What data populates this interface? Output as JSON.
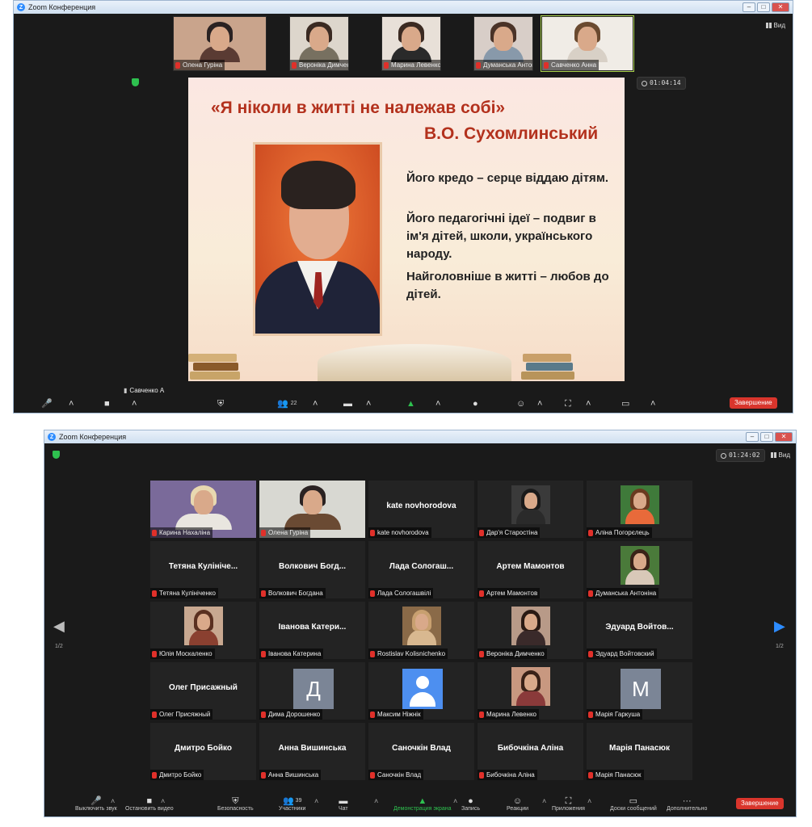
{
  "top": {
    "window_title": "Zoom Конференция",
    "thumbnails": [
      {
        "name": "Олена Гуріна",
        "bg": "#c9a48c",
        "hair": "#2a2222",
        "body": "#5a3b33"
      },
      {
        "name": "Вероніка Димченко",
        "bg": "#ddd6cc",
        "hair": "#3a2a22",
        "body": "#777060"
      },
      {
        "name": "Марина Левенко",
        "bg": "#e8e0d8",
        "hair": "#3b2a22",
        "body": "#2a2a2a"
      },
      {
        "name": "Думанська Антоніна",
        "bg": "#d8cec8",
        "hair": "#4a3328",
        "body": "#8899aa"
      },
      {
        "name": "Савченко Анна",
        "bg": "#f0ece6",
        "hair": "#6a4a30",
        "body": "#d8d0c6"
      }
    ],
    "view_label": "Вид",
    "timer": "01:04:14",
    "slide": {
      "quote": "«Я ніколи в житті не належав собі»",
      "author": "В.О. Сухомлинський",
      "lines": [
        "Його кредо – серце віддаю дітям.",
        "Його педагогічні ідеї – подвиг в ім'я дітей, школи, українського народу.",
        "Найголовніше в житті – любов до дітей."
      ]
    },
    "speaker_tag": "Савченко А",
    "participants_count": "22",
    "end_label": "Завершение"
  },
  "bottom": {
    "window_title": "Zoom Конференция",
    "timer": "01:24:02",
    "view_label": "Вид",
    "page_left": "1/2",
    "page_right": "1/2",
    "tiles": [
      {
        "big": "",
        "name": "Карина Нахаліна",
        "kind": "video",
        "bg": "#7a6a9a",
        "hair": "#e8d8b0",
        "body": "#e9e6df"
      },
      {
        "big": "",
        "name": "Олена Гуріна",
        "kind": "video",
        "bg": "#d8d8d2",
        "hair": "#2a2222",
        "body": "#6a4a33",
        "active": true
      },
      {
        "big": "kate novhorodova",
        "name": "kate novhorodova",
        "kind": "text"
      },
      {
        "big": "",
        "name": "Дар'я Старостіна",
        "kind": "photo",
        "bg": "#3a3a3a",
        "hair": "#1a1a1a",
        "body": "#2a2a2a"
      },
      {
        "big": "",
        "name": "Аліна Погорєлець",
        "kind": "photo",
        "bg": "#3f7a3a",
        "hair": "#6a3a20",
        "body": "#e86a3a"
      },
      {
        "big": "Тетяна Кулініче...",
        "name": "Тетяна Кулініченко",
        "kind": "text"
      },
      {
        "big": "Волкович Богд...",
        "name": "Волкович Богдана",
        "kind": "text"
      },
      {
        "big": "Лада Сологаш...",
        "name": "Лада Сологашвілі",
        "kind": "text"
      },
      {
        "big": "Артем Мамонтов",
        "name": "Артем Мамонтов",
        "kind": "text"
      },
      {
        "big": "",
        "name": "Думанська Антоніна",
        "kind": "photo",
        "bg": "#4a7a3a",
        "hair": "#3a2218",
        "body": "#d8c8b8"
      },
      {
        "big": "",
        "name": "Юлія Москаленко",
        "kind": "photo",
        "bg": "#c8a890",
        "hair": "#5a3020",
        "body": "#8a4030"
      },
      {
        "big": "Іванова Катери...",
        "name": "Іванова Катерина",
        "kind": "text"
      },
      {
        "big": "",
        "name": "Rostislav Kolisnichenko",
        "kind": "photo",
        "bg": "#8a6a48",
        "hair": "#c8a070",
        "body": "#d8b890"
      },
      {
        "big": "",
        "name": "Вероніка Димченко",
        "kind": "photo",
        "bg": "#b89a88",
        "hair": "#2a1a14",
        "body": "#3a2a2a"
      },
      {
        "big": "Эдуард Войтов...",
        "name": "Эдуард Войтовский",
        "kind": "text"
      },
      {
        "big": "Олег Присажный",
        "name": "Олег Присяжный",
        "kind": "text"
      },
      {
        "big": "",
        "name": "Дима Дорошенко",
        "kind": "letter",
        "letter": "Д"
      },
      {
        "big": "",
        "name": "Максим Ніжнік",
        "kind": "avatar"
      },
      {
        "big": "",
        "name": "Марина Левенко",
        "kind": "photo",
        "bg": "#c89880",
        "hair": "#3a2218",
        "body": "#8a3a3a"
      },
      {
        "big": "",
        "name": "Марія Гаркуша",
        "kind": "letter",
        "letter": "М"
      },
      {
        "big": "Дмитро Бойко",
        "name": "Дмитро Бойко",
        "kind": "text"
      },
      {
        "big": "Анна Вишинська",
        "name": "Анна Вишинська",
        "kind": "text"
      },
      {
        "big": "Саночкін Влад",
        "name": "Саночкін Влад",
        "kind": "text"
      },
      {
        "big": "Бибочкіна Аліна",
        "name": "Бибочкіна Аліна",
        "kind": "text"
      },
      {
        "big": "Марія Панасюк",
        "name": "Марія Панасюк",
        "kind": "text"
      }
    ],
    "toolbar": [
      {
        "icon": "mic-icon",
        "glyph": "🎤",
        "label": "Выключить звук",
        "color": "#2ec04f"
      },
      {
        "icon": "video-icon",
        "glyph": "■",
        "label": "Остановить видео",
        "color": "#ddd"
      },
      {
        "icon": "security-icon",
        "glyph": "⛨",
        "label": "Безопасность",
        "color": "#ddd"
      },
      {
        "icon": "participants-icon",
        "glyph": "👥",
        "label": "Участники",
        "count": "39",
        "color": "#ddd"
      },
      {
        "icon": "chat-icon",
        "glyph": "▬",
        "label": "Чат",
        "color": "#ddd"
      },
      {
        "icon": "share-screen-icon",
        "glyph": "▲",
        "label": "Демонстрация экрана",
        "color": "#2ec04f"
      },
      {
        "icon": "record-icon",
        "glyph": "●",
        "label": "Запись",
        "color": "#ddd"
      },
      {
        "icon": "reactions-icon",
        "glyph": "☺",
        "label": "Реакции",
        "color": "#ddd"
      },
      {
        "icon": "apps-icon",
        "glyph": "⛶",
        "label": "Приложения",
        "color": "#ddd"
      },
      {
        "icon": "whiteboard-icon",
        "glyph": "▭",
        "label": "Доски сообщений",
        "color": "#ddd"
      },
      {
        "icon": "more-icon",
        "glyph": "···",
        "label": "Дополнительно",
        "color": "#ddd"
      }
    ],
    "end_label": "Завершение"
  }
}
